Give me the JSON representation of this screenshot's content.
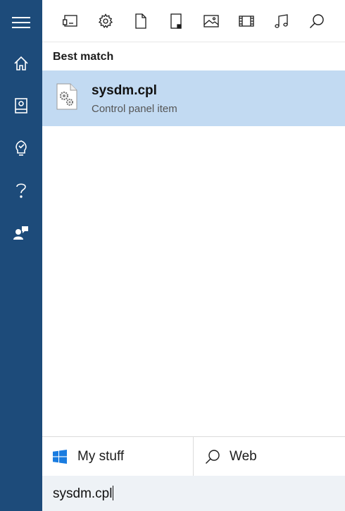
{
  "rail": {
    "items": [
      {
        "icon": "hamburger-icon"
      },
      {
        "icon": "home-icon"
      },
      {
        "icon": "notebook-icon"
      },
      {
        "icon": "lightbulb-icon"
      },
      {
        "icon": "question-icon"
      },
      {
        "icon": "feedback-icon"
      }
    ]
  },
  "filter_bar": {
    "items": [
      {
        "icon": "apps-icon"
      },
      {
        "icon": "settings-icon"
      },
      {
        "icon": "documents-icon"
      },
      {
        "icon": "folders-icon"
      },
      {
        "icon": "photos-icon"
      },
      {
        "icon": "videos-icon"
      },
      {
        "icon": "music-icon"
      },
      {
        "icon": "search-icon"
      }
    ]
  },
  "results": {
    "section_title": "Best match",
    "best_match": {
      "name": "sysdm.cpl",
      "type": "Control panel item",
      "icon": "control-panel-file-icon"
    }
  },
  "scope": {
    "my_stuff_label": "My stuff",
    "web_label": "Web",
    "my_stuff_icon": "windows-logo-icon",
    "web_icon": "search-icon"
  },
  "search": {
    "query": "sysdm.cpl"
  },
  "colors": {
    "rail_bg": "#1d4b7a",
    "selected_bg": "#c2daf2",
    "windows_blue": "#1a7ce0"
  }
}
